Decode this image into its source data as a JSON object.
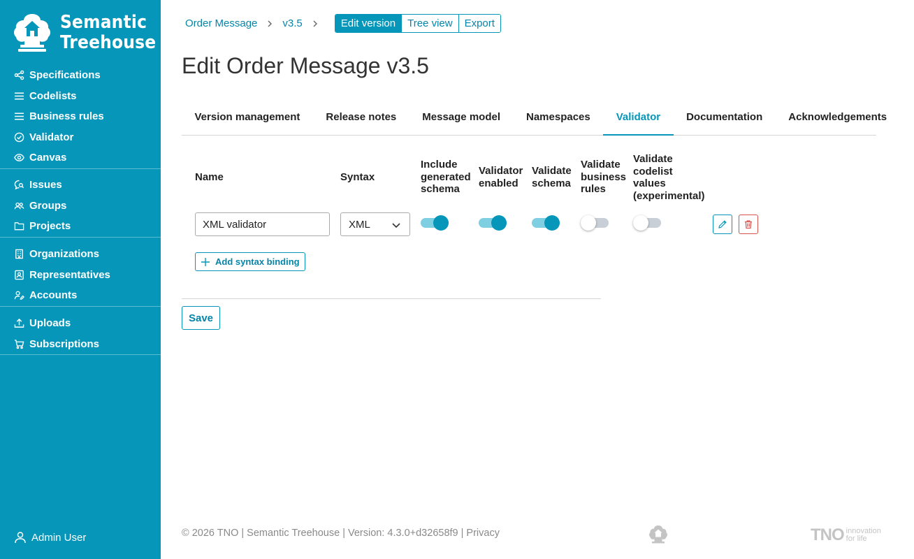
{
  "brand": {
    "line1": "Semantic",
    "line2": "Treehouse"
  },
  "sidebar": {
    "groups": [
      {
        "items": [
          {
            "label": "Specifications",
            "icon": "share-icon"
          },
          {
            "label": "Codelists",
            "icon": "list-icon"
          },
          {
            "label": "Business rules",
            "icon": "list-icon"
          },
          {
            "label": "Validator",
            "icon": "check-circle-icon"
          },
          {
            "label": "Canvas",
            "icon": "eye-icon"
          }
        ]
      },
      {
        "items": [
          {
            "label": "Issues",
            "icon": "chat-search-icon"
          },
          {
            "label": "Groups",
            "icon": "people-icon"
          },
          {
            "label": "Projects",
            "icon": "folder-icon"
          }
        ]
      },
      {
        "items": [
          {
            "label": "Organizations",
            "icon": "building-icon"
          },
          {
            "label": "Representatives",
            "icon": "id-card-icon"
          },
          {
            "label": "Accounts",
            "icon": "user-edit-icon"
          }
        ]
      },
      {
        "items": [
          {
            "label": "Uploads",
            "icon": "upload-icon"
          },
          {
            "label": "Subscriptions",
            "icon": "cart-icon"
          }
        ]
      }
    ],
    "user": "Admin User"
  },
  "breadcrumb": {
    "items": [
      "Order Message",
      "v3.5"
    ],
    "actions": [
      "Edit version",
      "Tree view",
      "Export"
    ],
    "active_action": "Edit version"
  },
  "page_title": "Edit Order Message v3.5",
  "tabs": [
    "Version management",
    "Release notes",
    "Message model",
    "Namespaces",
    "Validator",
    "Documentation",
    "Acknowledgements"
  ],
  "active_tab": "Validator",
  "validator_table": {
    "headers": {
      "name": "Name",
      "syntax": "Syntax",
      "include_generated_schema": "Include generated schema",
      "validator_enabled": "Validator enabled",
      "validate_schema": "Validate schema",
      "validate_business_rules": "Validate business rules",
      "validate_codelist_values": "Validate codelist values (experimental)"
    },
    "row": {
      "name": "XML validator",
      "syntax": "XML",
      "include_generated_schema": true,
      "validator_enabled": true,
      "validate_schema": true,
      "validate_business_rules": false,
      "validate_codelist_values": false
    }
  },
  "add_binding_label": "Add syntax binding",
  "save_label": "Save",
  "footer": "© 2026 TNO | Semantic Treehouse | Version: 4.3.0+d32658f9 | Privacy",
  "tno": {
    "mark": "TNO",
    "tag1": "innovation",
    "tag2": "for life"
  },
  "colors": {
    "primary": "#0596b9",
    "danger": "#d9534f"
  }
}
